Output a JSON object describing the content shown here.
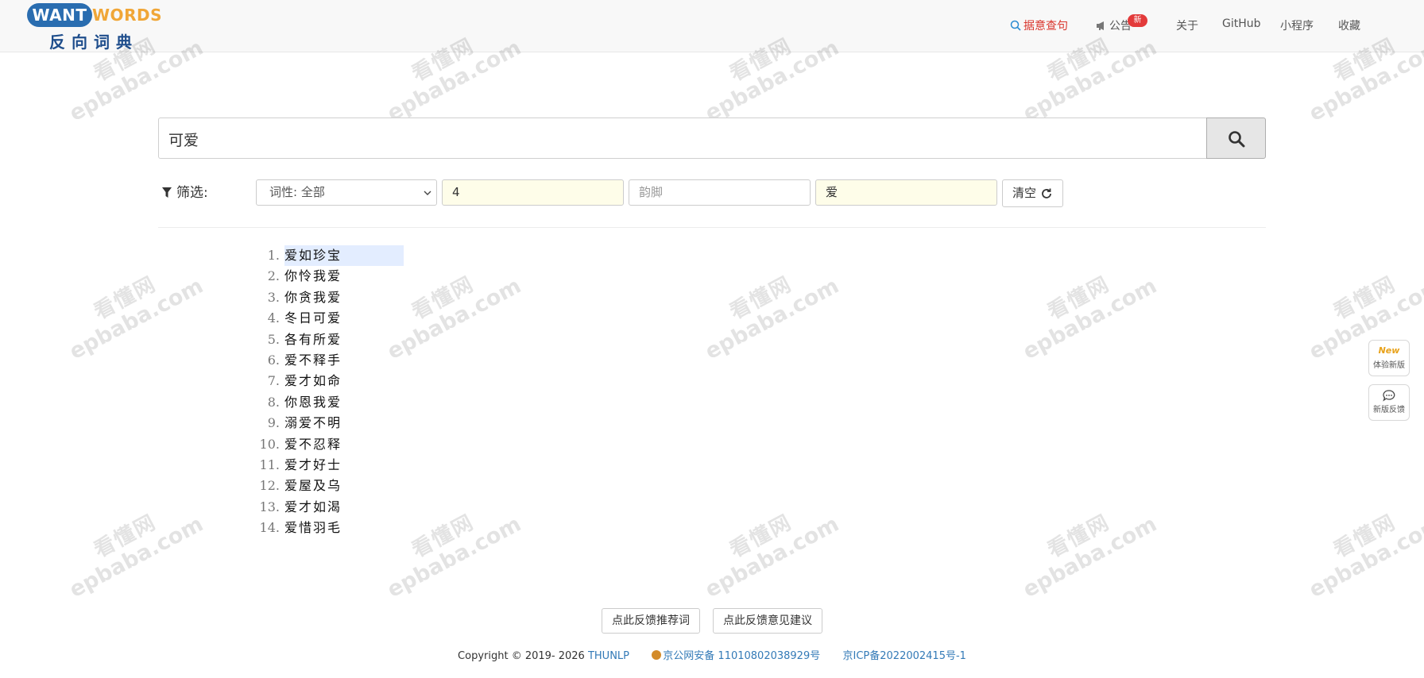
{
  "logo": {
    "brand_left": "WANT",
    "brand_right": "WORDS",
    "cn_name": "反向词典"
  },
  "nav": {
    "items": [
      {
        "label": "据意查句",
        "icon": "search-icon"
      },
      {
        "label": "公告",
        "icon": "megaphone-icon",
        "badge": "新"
      },
      {
        "label": "关于"
      },
      {
        "label": "GitHub"
      },
      {
        "label": "小程序"
      },
      {
        "label": "收藏"
      }
    ]
  },
  "search": {
    "value": "可爱",
    "button_icon": "search-icon"
  },
  "filter": {
    "label": "筛选:",
    "pos_select": "词性: 全部",
    "length_value": "4",
    "rhyme_placeholder": "韵脚",
    "char_value": "爱",
    "clear_label": "清空"
  },
  "results": [
    "爱如珍宝",
    "你怜我爱",
    "你贪我爱",
    "冬日可爱",
    "各有所爱",
    "爱不释手",
    "爱才如命",
    "你恩我爱",
    "溺爱不明",
    "爱不忍释",
    "爱才好士",
    "爱屋及乌",
    "爱才如渴",
    "爱惜羽毛"
  ],
  "footer": {
    "recommend_btn": "点此反馈推荐词",
    "suggest_btn": "点此反馈意见建议",
    "copyright": "Copyright © 2019- 2026",
    "org": "THUNLP",
    "police_record": "京公网安备 11010802038929号",
    "icp": "京ICP备2022002415号-1"
  },
  "side": {
    "new_version_mark": "New",
    "new_version_label": "体验新版",
    "feedback_label": "新版反馈"
  },
  "watermark": {
    "cn": "看懂网",
    "en": "epbaba.com"
  },
  "colors": {
    "accent_red": "#d9352c",
    "link_blue": "#337ab7",
    "filled_field": "#fefde9",
    "badge_red": "#e33b3b"
  }
}
